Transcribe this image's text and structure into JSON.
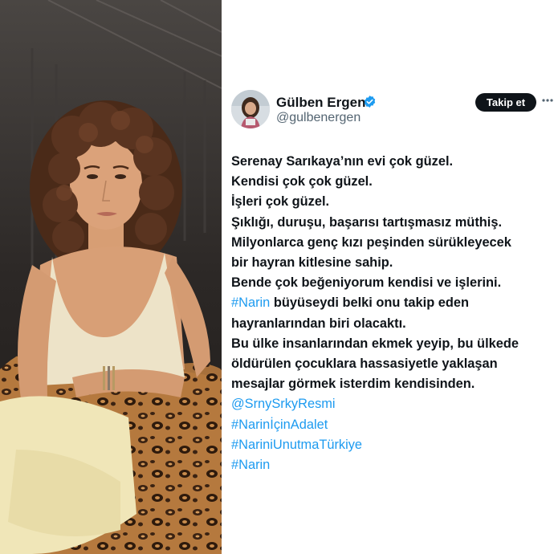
{
  "tweet": {
    "author": {
      "display_name": "Gülben Ergen",
      "handle": "@gulbenergen",
      "verified_icon": "verified-badge-icon",
      "verified_color": "#1d9bf0"
    },
    "follow_label": "Takip et",
    "more_icon": "more-dots-icon",
    "lines": [
      "Serenay Sarıkaya’nın evi çok güzel.",
      "Kendisi çok çok güzel.",
      "İşleri çok güzel.",
      "Şıklığı, duruşu, başarısı tartışmasız müthiş.",
      "Milyonlarca genç kızı peşinden sürükleyecek",
      "bir hayran kitlesine sahip.",
      "Bende çok beğeniyorum kendisi ve işlerini.",
      {
        "tag": "#Narin",
        "rest": " büyüseydi belki onu takip eden"
      },
      "hayranlarından biri olacaktı.",
      "Bu ülke insanlarından ekmek yeyip, bu ülkede",
      "öldürülen çocuklara hassasiyetle yaklaşan",
      "mesajlar görmek isterdim kendisinden."
    ],
    "links": [
      "@SrnySrkyResmi",
      "#NarinİçinAdalet",
      "#NariniUnutmaTürkiye",
      "#Narin"
    ]
  },
  "colors": {
    "text": "#0f1419",
    "secondary": "#536471",
    "link": "#1d9bf0",
    "button_bg": "#0f1419"
  }
}
